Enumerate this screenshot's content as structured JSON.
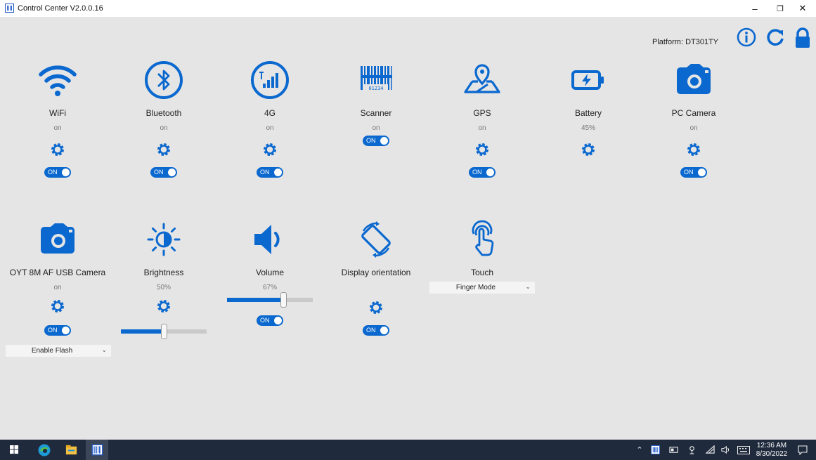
{
  "window": {
    "title": "Control Center V2.0.0.16",
    "minimize_glyph": "–",
    "maximize_glyph": "❐",
    "close_glyph": "✕"
  },
  "header": {
    "platform": "Platform: DT301TY",
    "icons": [
      "info-icon",
      "refresh-icon",
      "lock-icon"
    ]
  },
  "colors": {
    "accent": "#0a68cf",
    "background": "#e5e5e5",
    "taskbar": "#1f2a3c"
  },
  "tiles": [
    {
      "name": "WiFi",
      "status": "on",
      "icon": "wifi-icon",
      "toggle": "ON"
    },
    {
      "name": "Bluetooth",
      "status": "on",
      "icon": "bluetooth-icon",
      "toggle": "ON"
    },
    {
      "name": "4G",
      "status": "on",
      "icon": "cellular-signal-icon",
      "toggle": "ON"
    },
    {
      "name": "Scanner",
      "status": "on",
      "icon": "barcode-icon",
      "toggle": "ON"
    },
    {
      "name": "GPS",
      "status": "on",
      "icon": "gps-icon",
      "toggle": "ON"
    },
    {
      "name": "Battery",
      "status": "45%",
      "icon": "battery-icon"
    },
    {
      "name": "PC Camera",
      "status": "on",
      "icon": "camera-icon",
      "toggle": "ON"
    },
    {
      "name": "OYT 8M AF USB Camera",
      "status": "on",
      "icon": "camera-icon",
      "toggle": "ON",
      "dropdown": "Enable Flash"
    },
    {
      "name": "Brightness",
      "status": "50%",
      "icon": "brightness-icon",
      "slider": 0.5
    },
    {
      "name": "Volume",
      "status": "67%",
      "icon": "volume-icon",
      "slider": 0.67,
      "toggle": "ON"
    },
    {
      "name": "Display orientation",
      "status": "",
      "icon": "rotate-icon",
      "toggle": "ON"
    },
    {
      "name": "Touch",
      "status": "",
      "icon": "touch-icon",
      "dropdown": "Finger Mode"
    }
  ],
  "taskbar": {
    "time": "12:36 AM",
    "date": "8/30/2022"
  }
}
